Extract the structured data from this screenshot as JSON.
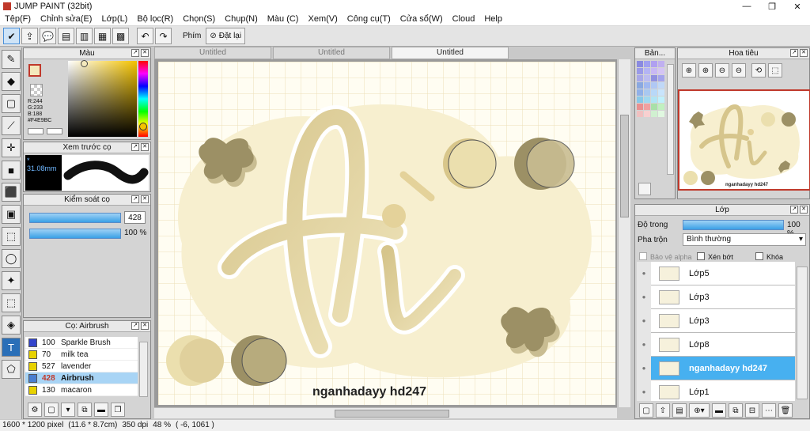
{
  "window": {
    "title": "JUMP PAINT (32bit)",
    "controls": [
      "—",
      "❐",
      "✕"
    ]
  },
  "menu": [
    "Tệp(F)",
    "Chỉnh sửa(E)",
    "Lớp(L)",
    "Bộ lọc(R)",
    "Chọn(S)",
    "Chụp(N)",
    "Màu (C)",
    "Xem(V)",
    "Công cụ(T)",
    "Cửa sổ(W)",
    "Cloud",
    "Help"
  ],
  "toolbar": {
    "icons": [
      "✔",
      "⇪",
      "💬",
      "▤",
      "▥",
      "▦",
      "▩"
    ],
    "undo": "↶",
    "redo": "↷",
    "key_label": "Phím",
    "reset_label": "Đặt lại",
    "reset_icon": "⊘"
  },
  "tools": [
    "✎",
    "◆",
    "▢",
    "⟋",
    "✛",
    "■",
    "⬛",
    "▣",
    "⬚",
    "◯",
    "✦",
    "⬚",
    "◈",
    "T",
    "⬠"
  ],
  "color_panel": {
    "title": "Màu",
    "r": "R:244",
    "g": "G:233",
    "b": "B:188",
    "hex": "#F4E9BC",
    "fg_color": "#F4E9BC",
    "bg_color": "#ffffff"
  },
  "brush_preview": {
    "title": "Xem trước cọ",
    "size": "* 31.08mm"
  },
  "brush_control": {
    "title": "Kiểm soát cọ",
    "size_value": "428",
    "opacity_value": "100 %"
  },
  "brush_list": {
    "title": "Cọ: Airbrush",
    "items": [
      {
        "size": "100",
        "name": "Sparkle Brush",
        "color": "#3344cc"
      },
      {
        "size": "70",
        "name": "milk tea",
        "color": "#e8d200"
      },
      {
        "size": "527",
        "name": "lavender",
        "color": "#e8d200"
      },
      {
        "size": "428",
        "name": "Airbrush",
        "color": "#4a7fd0",
        "selected": true
      },
      {
        "size": "130",
        "name": "macaron",
        "color": "#e8d200"
      }
    ]
  },
  "tabs": [
    "Untitled",
    "Untitled",
    "Untitled"
  ],
  "active_tab": 2,
  "canvas": {
    "text": "nganhadayy hd247",
    "colors": {
      "beige": "#f4e9bc",
      "olive": "#9c9065",
      "gold": "#d8c68a"
    }
  },
  "palette_panel": {
    "title": "Bản..."
  },
  "navigator": {
    "title": "Hoa tiêu",
    "caption": "nganhadayy hd247"
  },
  "layers": {
    "title": "Lớp",
    "opacity_label": "Độ trong",
    "opacity_value": "100 %",
    "blend_label": "Pha trộn",
    "blend_value": "Bình thường",
    "protect_alpha": "Bảo vệ alpha",
    "clip": "Xén bớt",
    "lock": "Khóa",
    "items": [
      {
        "name": "Lớp5"
      },
      {
        "name": "Lớp3"
      },
      {
        "name": "Lớp3"
      },
      {
        "name": "Lớp8"
      },
      {
        "name": "nganhadayy hd247",
        "selected": true
      },
      {
        "name": "Lớp1"
      }
    ]
  },
  "status": {
    "size": "1600 * 1200 pixel",
    "cm": "(11.6 * 8.7cm)",
    "dpi": "350 dpi",
    "zoom": "48 %",
    "coords": "( -6, 1061 )"
  }
}
